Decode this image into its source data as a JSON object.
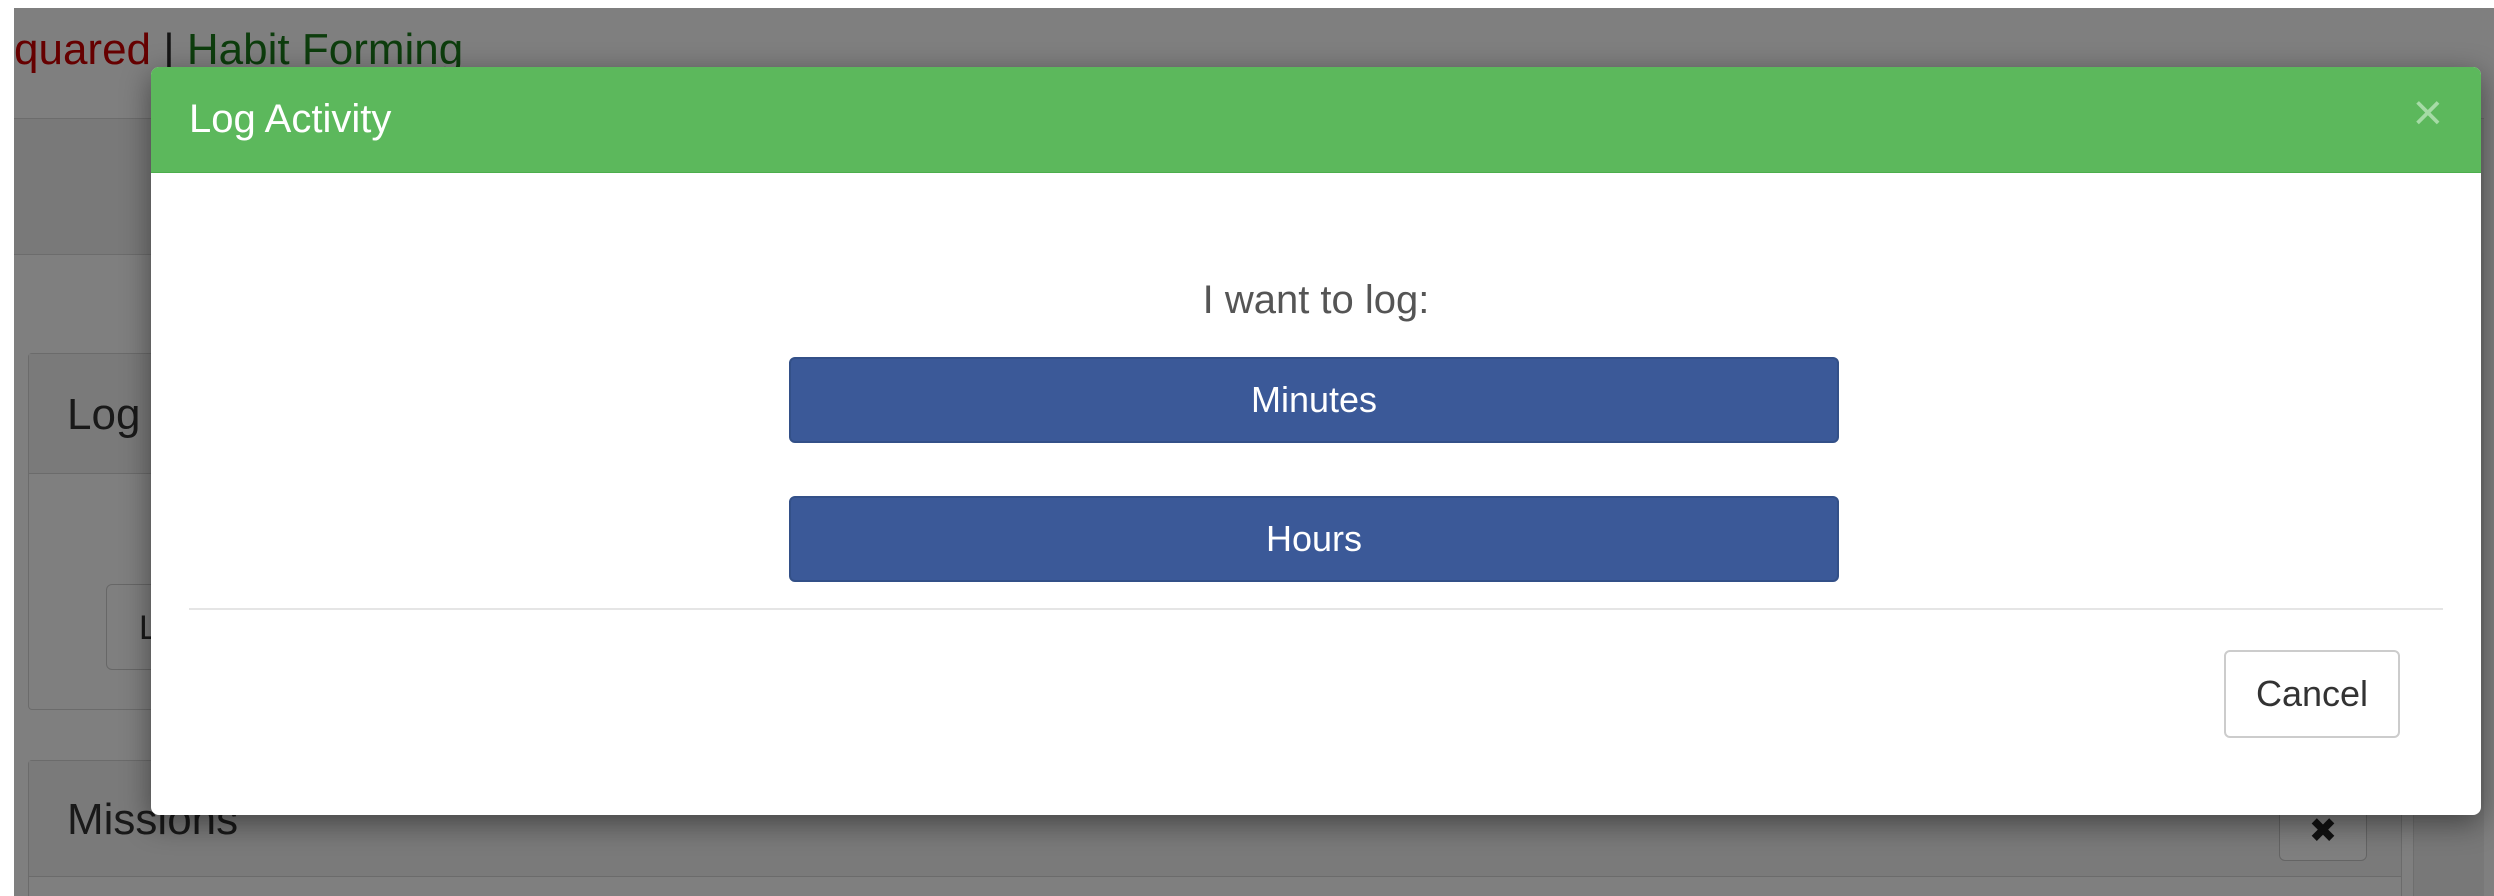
{
  "brand": {
    "part_red": "quared",
    "separator": " | ",
    "part_green": "Habit Forming"
  },
  "panels": {
    "log_heading": "Log",
    "log_button_label": "L",
    "missions_heading": "Missions",
    "missions_close_icon": "close-icon"
  },
  "modal": {
    "title": "Log Activity",
    "close_glyph": "×",
    "prompt": "I want to log:",
    "options": [
      {
        "label": "Minutes"
      },
      {
        "label": "Hours"
      }
    ],
    "cancel_label": "Cancel"
  },
  "colors": {
    "header_green": "#5cb85c",
    "button_blue": "#3b5998",
    "brand_red": "#cc0000",
    "brand_green": "#1a7a1a"
  }
}
